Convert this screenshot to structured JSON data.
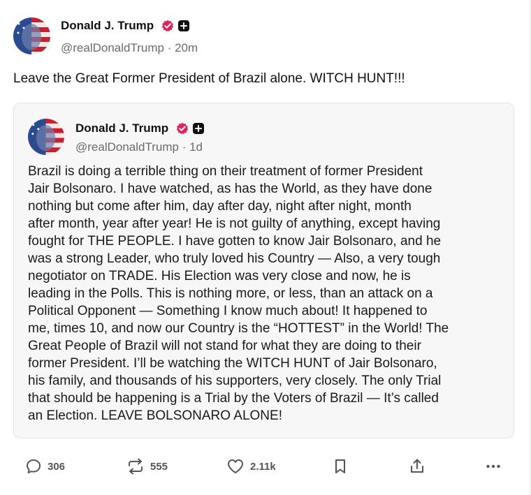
{
  "post": {
    "author_name": "Donald J. Trump",
    "handle": "@realDonaldTrump",
    "time": "20m",
    "text": "Leave the Great Former President of Brazil alone. WITCH HUNT!!!"
  },
  "quoted_post": {
    "author_name": "Donald J. Trump",
    "handle": "@realDonaldTrump",
    "time": "1d",
    "text": "Brazil is doing a terrible thing on their treatment of former President\nJair Bolsonaro. I have watched, as has the World, as they have done\nnothing but come after him, day after day, night after night, month\nafter month, year after year! He is not guilty of anything, except having\nfought for THE PEOPLE. I have gotten to know Jair Bolsonaro, and he\nwas a strong Leader, who truly loved his Country — Also, a very tough\nnegotiator on TRADE. His Election was very close and now, he is\nleading in the Polls. This is nothing more, or less, than an attack on a\nPolitical Opponent — Something I know much about! It happened to\nme, times 10, and now our Country is the “HOTTEST” in the World! The\nGreat People of Brazil will not stand for what they are doing to their\nformer President. I’ll be watching the WITCH HUNT of Jair Bolsonaro,\nhis family, and thousands of his supporters, very closely. The only Trial\nthat should be happening is a Trial by the Voters of Brazil — It’s called\nan Election. LEAVE BOLSONARO ALONE!"
  },
  "actions": {
    "replies": "306",
    "reposts": "555",
    "likes": "2.11k"
  },
  "icons": {
    "verified": "verified-badge-icon",
    "plus": "plus-badge-icon",
    "reply": "reply-icon",
    "repost": "repost-icon",
    "like": "heart-icon",
    "bookmark": "bookmark-icon",
    "share": "share-icon",
    "more": "more-icon"
  },
  "colors": {
    "verified": "#e0245e",
    "text": "#111111",
    "muted": "#6b6b6b",
    "quote_bg": "#f7f7f8"
  }
}
